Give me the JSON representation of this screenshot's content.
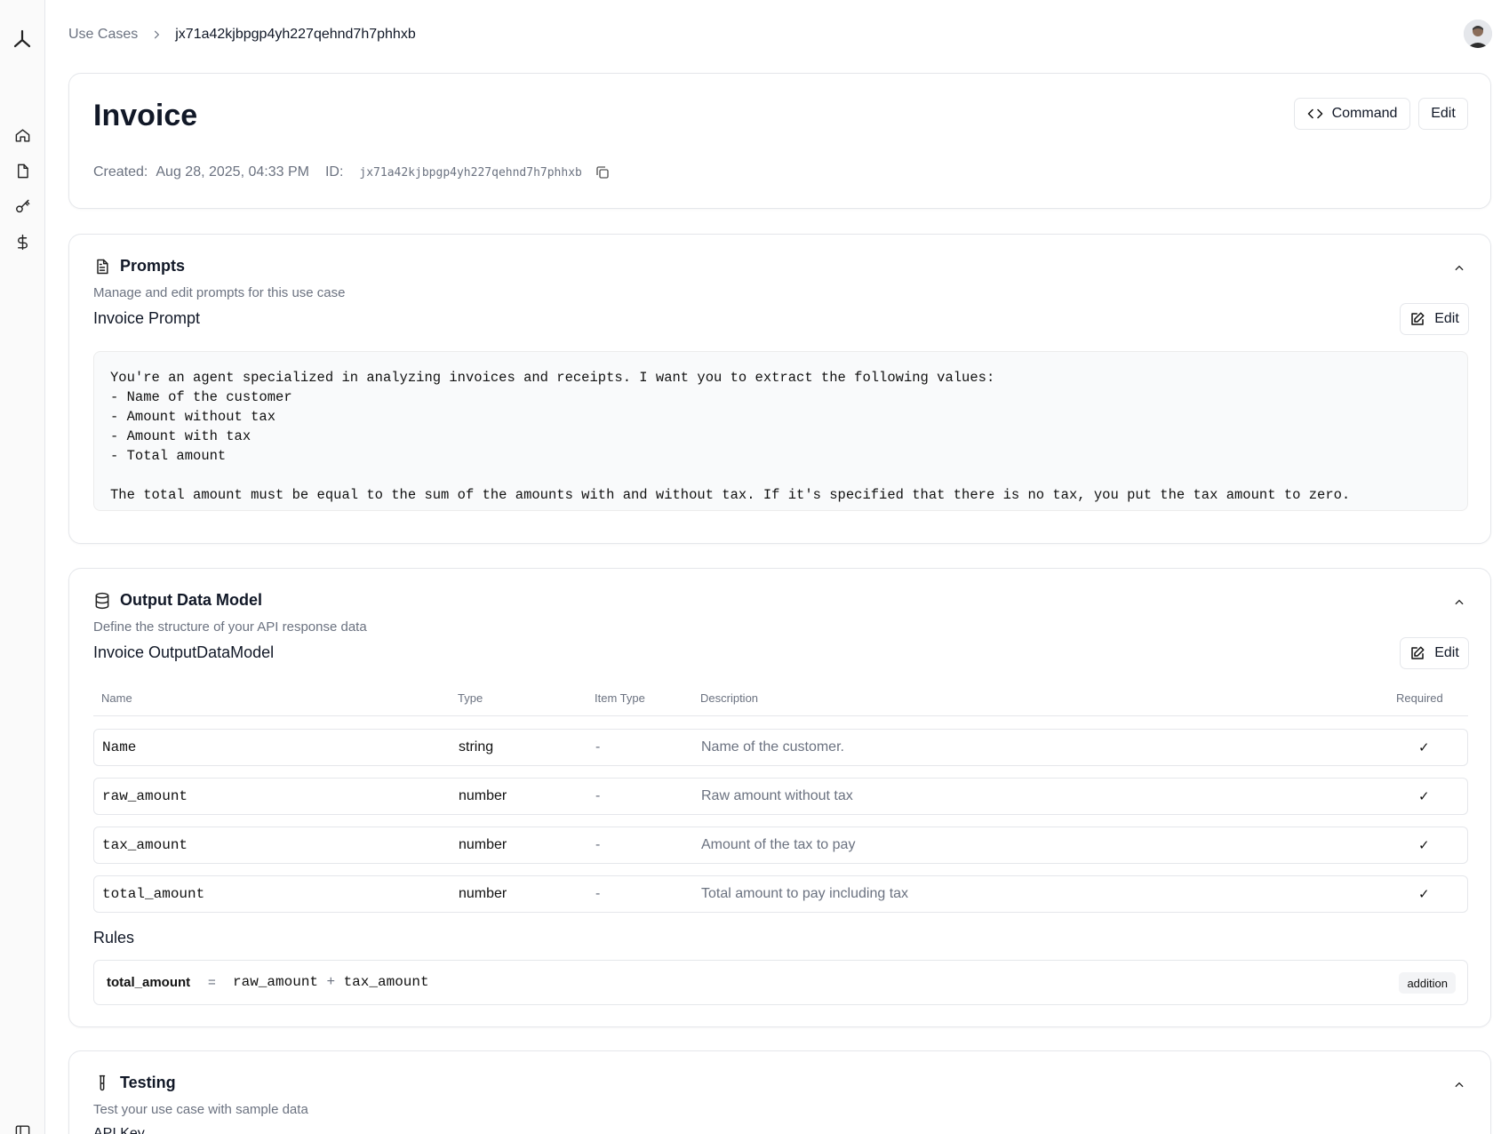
{
  "sidebar": {
    "logo": "app-logo",
    "items": [
      {
        "name": "home",
        "icon": "home-icon"
      },
      {
        "name": "documents",
        "icon": "file-icon"
      },
      {
        "name": "api-keys",
        "icon": "key-icon"
      },
      {
        "name": "billing",
        "icon": "dollar-icon"
      }
    ],
    "toggle_icon": "sidebar-toggle-icon"
  },
  "breadcrumb": {
    "parent": "Use Cases",
    "current": "jx71a42kjbpgp4yh227qehnd7h7phhxb"
  },
  "header": {
    "title": "Invoice",
    "command_label": "Command",
    "edit_label": "Edit",
    "created_label": "Created:",
    "created_value": "Aug 28, 2025, 04:33 PM",
    "id_label": "ID:",
    "id_value": "jx71a42kjbpgp4yh227qehnd7h7phhxb"
  },
  "prompts": {
    "title": "Prompts",
    "description": "Manage and edit prompts for this use case",
    "prompt_title": "Invoice Prompt",
    "edit_label": "Edit",
    "prompt_text": "You're an agent specialized in analyzing invoices and receipts. I want you to extract the following values:\n- Name of the customer\n- Amount without tax\n- Amount with tax\n- Total amount\n\nThe total amount must be equal to the sum of the amounts with and without tax. If it's specified that there is no tax, you put the tax amount to zero."
  },
  "output_model": {
    "title": "Output Data Model",
    "description": "Define the structure of your API response data",
    "model_title": "Invoice OutputDataModel",
    "edit_label": "Edit",
    "columns": [
      "Name",
      "Type",
      "Item Type",
      "Description",
      "Required"
    ],
    "rows": [
      {
        "name": "Name",
        "type": "string",
        "item_type": "-",
        "description": "Name of the customer.",
        "required": "✓"
      },
      {
        "name": "raw_amount",
        "type": "number",
        "item_type": "-",
        "description": "Raw amount without tax",
        "required": "✓"
      },
      {
        "name": "tax_amount",
        "type": "number",
        "item_type": "-",
        "description": "Amount of the tax to pay",
        "required": "✓"
      },
      {
        "name": "total_amount",
        "type": "number",
        "item_type": "-",
        "description": "Total amount to pay including tax",
        "required": "✓"
      }
    ],
    "rules_label": "Rules",
    "rule": {
      "target": "total_amount",
      "equals": "=",
      "left": "raw_amount",
      "operator": "+",
      "right": "tax_amount",
      "badge": "addition"
    }
  },
  "testing": {
    "title": "Testing",
    "description": "Test your use case with sample data",
    "api_key_label": "API Key"
  }
}
